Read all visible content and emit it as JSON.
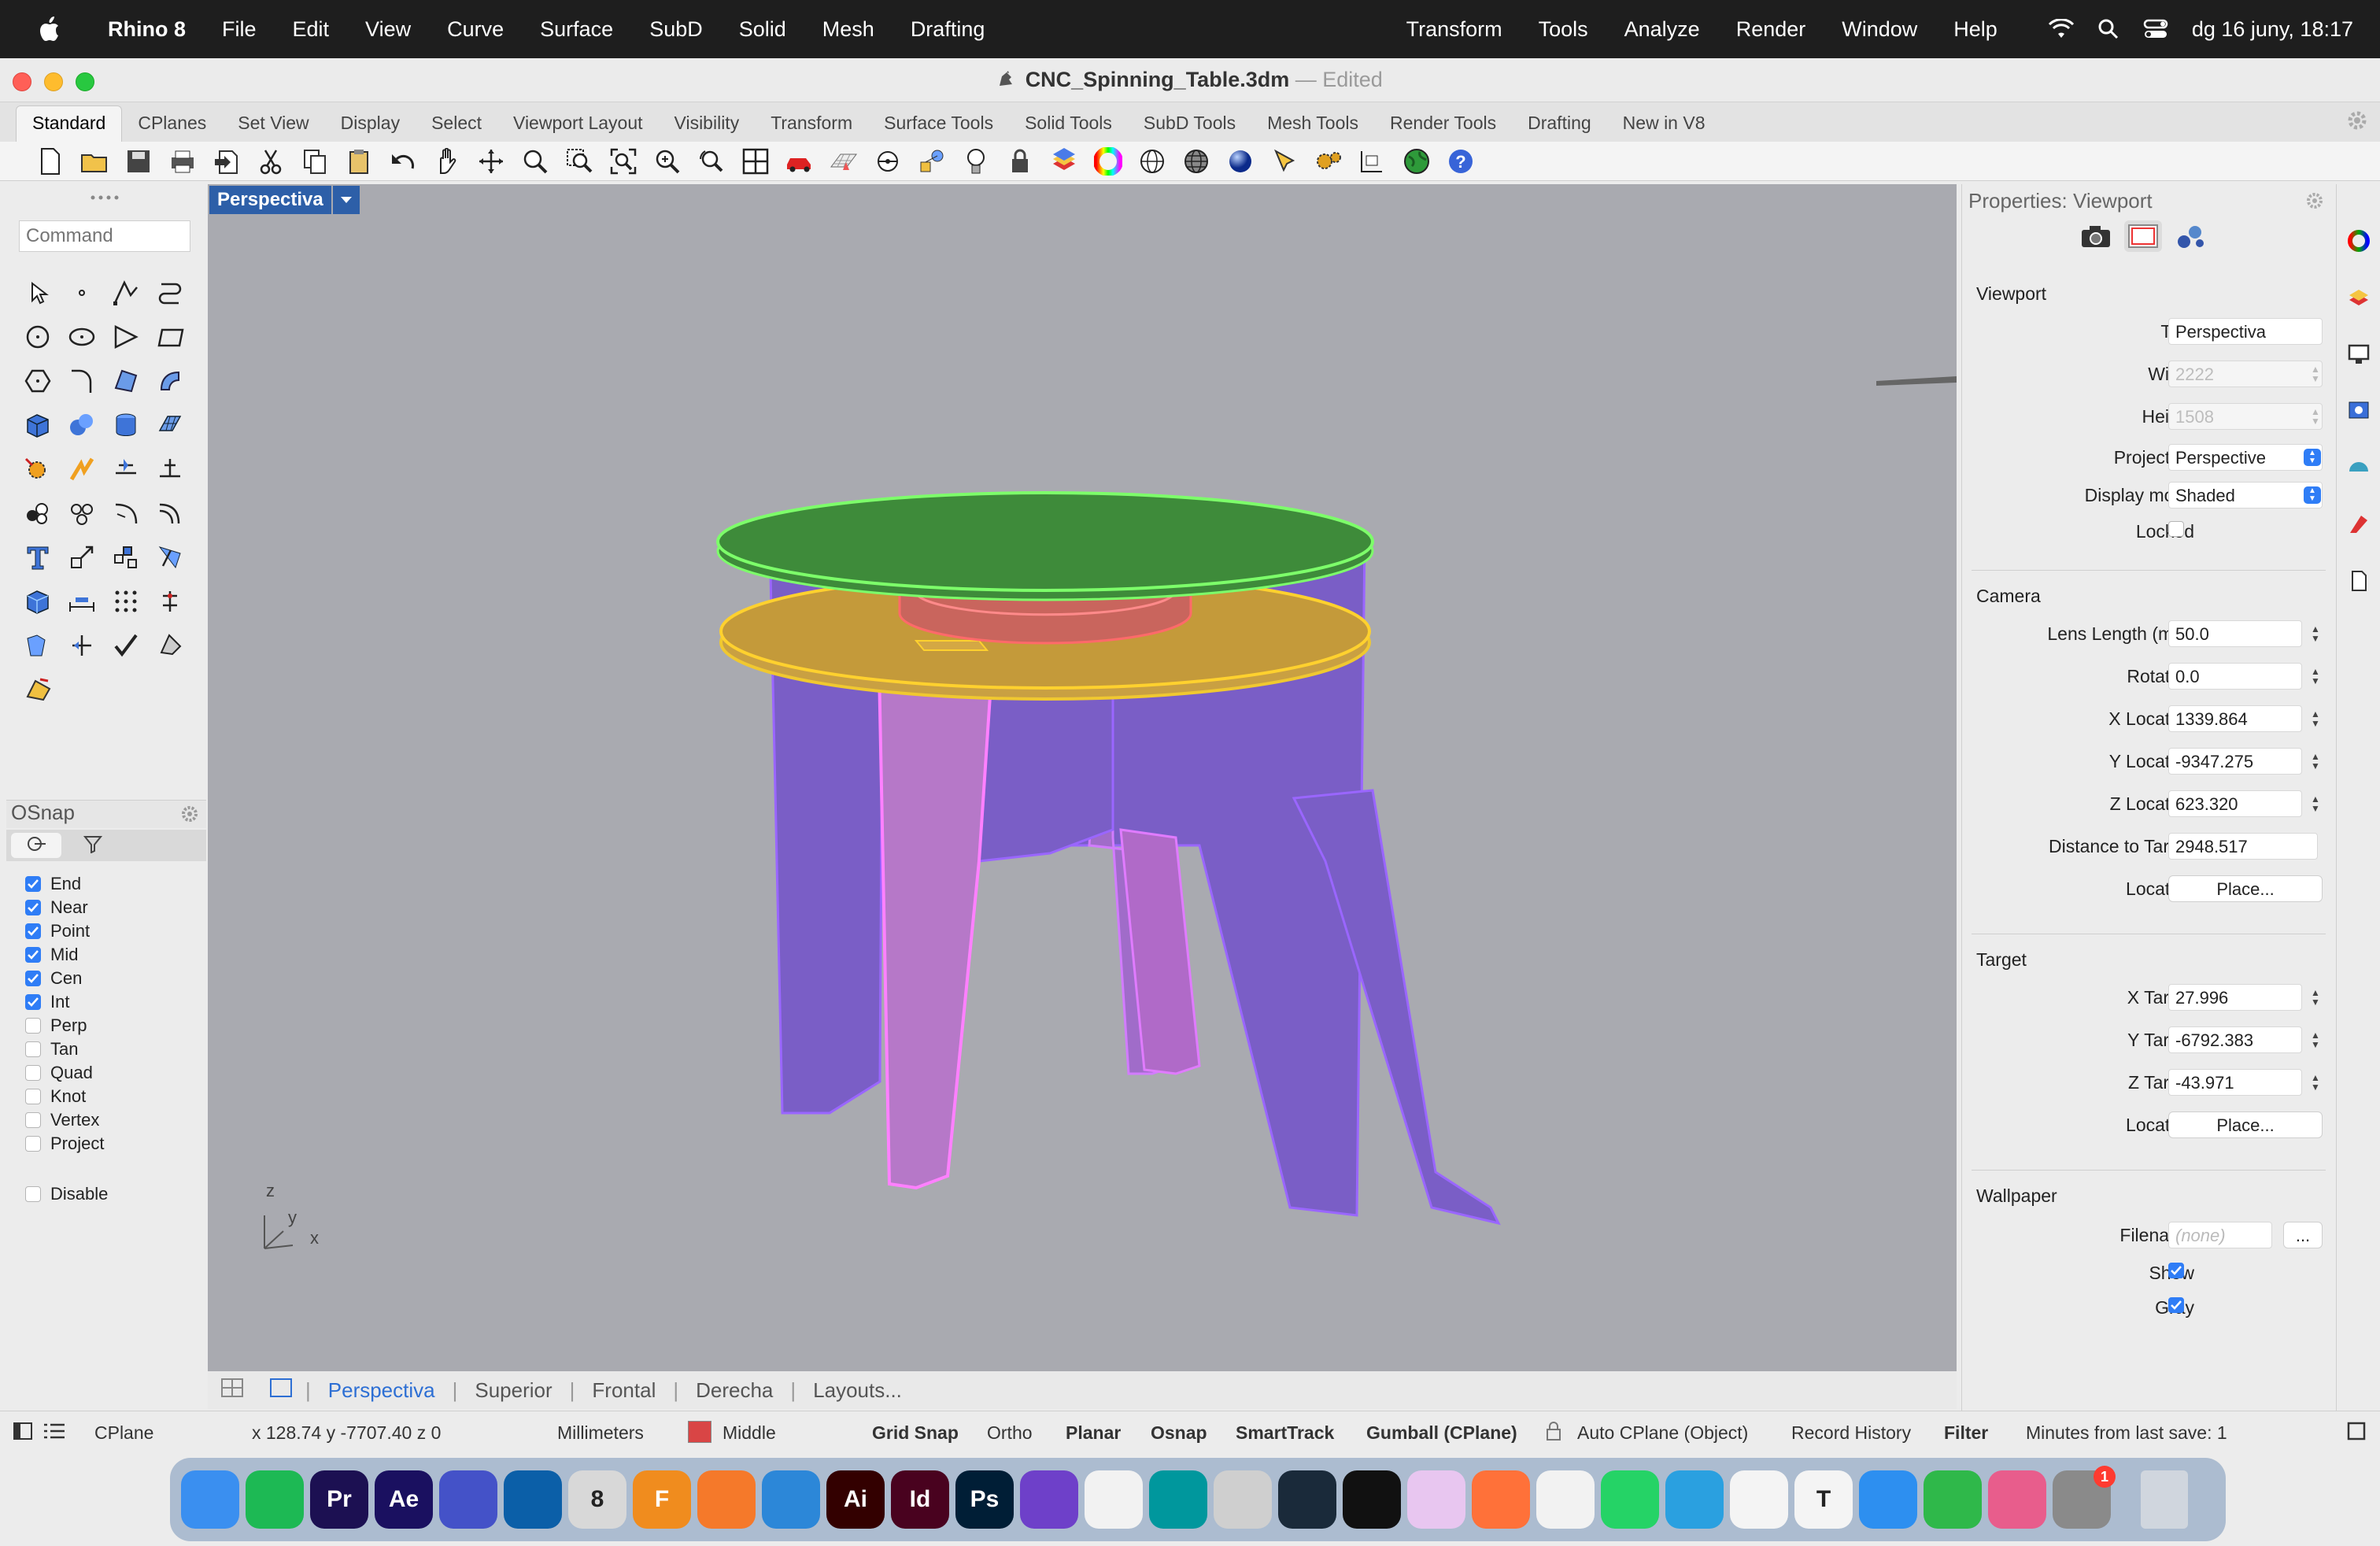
{
  "menubar": {
    "app_name": "Rhino 8",
    "items": [
      "File",
      "Edit",
      "View",
      "Curve",
      "Surface",
      "SubD",
      "Solid",
      "Mesh",
      "Drafting"
    ],
    "right_items": [
      "Transform",
      "Tools",
      "Analyze",
      "Render",
      "Window",
      "Help"
    ],
    "clock": "dg 16 juny, 18:17"
  },
  "window": {
    "filename": "CNC_Spinning_Table.3dm",
    "separator": "—",
    "edited": "Edited"
  },
  "toolbar_tabs": [
    "Standard",
    "CPlanes",
    "Set View",
    "Display",
    "Select",
    "Viewport Layout",
    "Visibility",
    "Transform",
    "Surface Tools",
    "Solid Tools",
    "SubD Tools",
    "Mesh Tools",
    "Render Tools",
    "Drafting",
    "New in V8"
  ],
  "command": {
    "placeholder": "Command"
  },
  "osnap": {
    "title": "OSnap",
    "items": [
      {
        "label": "End",
        "checked": true
      },
      {
        "label": "Near",
        "checked": true
      },
      {
        "label": "Point",
        "checked": true
      },
      {
        "label": "Mid",
        "checked": true
      },
      {
        "label": "Cen",
        "checked": true
      },
      {
        "label": "Int",
        "checked": true
      },
      {
        "label": "Perp",
        "checked": false
      },
      {
        "label": "Tan",
        "checked": false
      },
      {
        "label": "Quad",
        "checked": false
      },
      {
        "label": "Knot",
        "checked": false
      },
      {
        "label": "Vertex",
        "checked": false
      },
      {
        "label": "Project",
        "checked": false
      }
    ],
    "disable": "Disable"
  },
  "viewport": {
    "title": "Perspectiva",
    "axis_z": "z",
    "axis_y": "y",
    "axis_x": "x",
    "tabs": [
      "Perspectiva",
      "Superior",
      "Frontal",
      "Derecha",
      "Layouts..."
    ]
  },
  "properties": {
    "title": "Properties: Viewport",
    "viewport_section": "Viewport",
    "title_label": "Title",
    "title_value": "Perspectiva",
    "width_label": "Width",
    "width_value": "2222",
    "height_label": "Height",
    "height_value": "1508",
    "projection_label": "Projection",
    "projection_value": "Perspective",
    "display_label": "Display mode",
    "display_value": "Shaded",
    "locked_label": "Locked",
    "camera_section": "Camera",
    "lens_label": "Lens Length (mm)",
    "lens_value": "50.0",
    "rotation_label": "Rotation",
    "rotation_value": "0.0",
    "xloc_label": "X Location",
    "xloc_value": "1339.864",
    "yloc_label": "Y Location",
    "yloc_value": "-9347.275",
    "zloc_label": "Z Location",
    "zloc_value": "623.320",
    "dist_label": "Distance to Target",
    "dist_value": "2948.517",
    "location_label": "Location",
    "place_button": "Place...",
    "target_section": "Target",
    "xt_label": "X Target",
    "xt_value": "27.996",
    "yt_label": "Y Target",
    "yt_value": "-6792.383",
    "zt_label": "Z Target",
    "zt_value": "-43.971",
    "tloc_label": "Location",
    "tplace_button": "Place...",
    "wallpaper_section": "Wallpaper",
    "filename_label": "Filename",
    "filename_value": "(none)",
    "browse_button": "...",
    "show_label": "Show",
    "gray_label": "Gray"
  },
  "statusbar": {
    "cplane": "CPlane",
    "coords": "x 128.74  y -7707.40  z 0",
    "units": "Millimeters",
    "layer": "Middle",
    "layer_color": "#d94545",
    "grid_snap": "Grid Snap",
    "ortho": "Ortho",
    "planar": "Planar",
    "osnap": "Osnap",
    "smarttrack": "SmartTrack",
    "gumball": "Gumball (CPlane)",
    "auto_cplane": "Auto CPlane (Object)",
    "record": "Record History",
    "filter": "Filter",
    "minutes": "Minutes from last save: 1"
  },
  "dock": {
    "badge": "1",
    "apps": [
      {
        "name": "finder",
        "glyph": "",
        "color": "#3a8ff0"
      },
      {
        "name": "spotify",
        "glyph": "",
        "color": "#1db954"
      },
      {
        "name": "premiere",
        "glyph": "Pr",
        "color": "#1c1052"
      },
      {
        "name": "after-effects",
        "glyph": "Ae",
        "color": "#1a1060"
      },
      {
        "name": "affinity",
        "glyph": "",
        "color": "#4452c8"
      },
      {
        "name": "sketchup",
        "glyph": "",
        "color": "#0b5fa8"
      },
      {
        "name": "rhino",
        "glyph": "8",
        "color": "#d8d8d8"
      },
      {
        "name": "fusion",
        "glyph": "F",
        "color": "#f08c1e"
      },
      {
        "name": "blender",
        "glyph": "",
        "color": "#f5792a"
      },
      {
        "name": "safari-like",
        "glyph": "",
        "color": "#2c87d8"
      },
      {
        "name": "illustrator",
        "glyph": "Ai",
        "color": "#330000"
      },
      {
        "name": "indesign",
        "glyph": "Id",
        "color": "#49021f"
      },
      {
        "name": "photoshop",
        "glyph": "Ps",
        "color": "#001e36"
      },
      {
        "name": "github",
        "glyph": "",
        "color": "#6e40c9"
      },
      {
        "name": "vscode",
        "glyph": "",
        "color": "#f2f2f2"
      },
      {
        "name": "arduino",
        "glyph": "",
        "color": "#00979d"
      },
      {
        "name": "machine",
        "glyph": "",
        "color": "#cfcfcf"
      },
      {
        "name": "app-teal",
        "glyph": "",
        "color": "#1a2a3a"
      },
      {
        "name": "terminal",
        "glyph": "",
        "color": "#111111"
      },
      {
        "name": "app-pink",
        "glyph": "",
        "color": "#e8c6f0"
      },
      {
        "name": "firefox",
        "glyph": "",
        "color": "#ff7139"
      },
      {
        "name": "chrome",
        "glyph": "",
        "color": "#f2f2f2"
      },
      {
        "name": "whatsapp",
        "glyph": "",
        "color": "#25d366"
      },
      {
        "name": "telegram",
        "glyph": "",
        "color": "#2aa0e0"
      },
      {
        "name": "chatgpt",
        "glyph": "",
        "color": "#f4f4f4"
      },
      {
        "name": "typora",
        "glyph": "T",
        "color": "#f4f4f4"
      },
      {
        "name": "keynote",
        "glyph": "",
        "color": "#2d8ff0"
      },
      {
        "name": "numbers",
        "glyph": "",
        "color": "#2fb84a"
      },
      {
        "name": "pages-like",
        "glyph": "",
        "color": "#e85d8c"
      },
      {
        "name": "system-settings",
        "glyph": "",
        "color": "#8a8a8a"
      },
      {
        "name": "trash",
        "glyph": "",
        "color": "#d0d6de"
      }
    ]
  }
}
